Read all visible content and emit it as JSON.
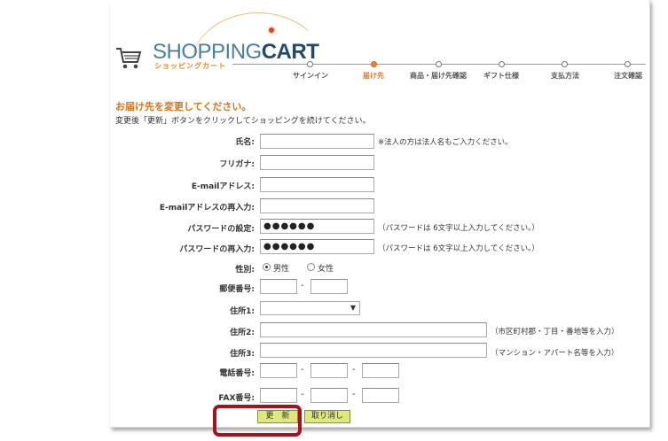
{
  "logo": {
    "main_light": "SHOPPING",
    "main_bold": "CART",
    "sub": "ショッピングカート"
  },
  "steps": [
    {
      "label": "サインイン",
      "active": false
    },
    {
      "label": "届け先",
      "active": true
    },
    {
      "label": "商品・届け先確認",
      "active": false
    },
    {
      "label": "ギフト仕様",
      "active": false
    },
    {
      "label": "支払方法",
      "active": false
    },
    {
      "label": "注文確認",
      "active": false
    }
  ],
  "form": {
    "title": "お届け先を変更してください。",
    "description": "変更後「更新」ボタンをクリックしてショッピングを続けてください。",
    "name": {
      "label": "氏名:",
      "value": "",
      "hint": "※法人の方は法人名もご入力ください。"
    },
    "furigana": {
      "label": "フリガナ:",
      "value": ""
    },
    "email": {
      "label": "E-mailアドレス:",
      "value": ""
    },
    "email_confirm": {
      "label": "E-mailアドレスの再入力:",
      "value": ""
    },
    "password": {
      "label": "パスワードの設定:",
      "value": "●●●●●●",
      "hint": "（パスワードは 6文字以上入力してください。）"
    },
    "password_confirm": {
      "label": "パスワードの再入力:",
      "value": "●●●●●●",
      "hint": "（パスワードは 6文字以上入力してください。）"
    },
    "gender": {
      "label": "性別:",
      "options": [
        "男性",
        "女性"
      ],
      "selected": "男性"
    },
    "postal": {
      "label": "郵便番号:",
      "part1": "",
      "part2": "",
      "sep": "-"
    },
    "address1": {
      "label": "住所1:",
      "selected": ""
    },
    "address2": {
      "label": "住所2:",
      "value": "",
      "hint": "（市区町村郡・丁目・番地等を入力）"
    },
    "address3": {
      "label": "住所3:",
      "value": "",
      "hint": "（マンション・アパート名等を入力）"
    },
    "phone": {
      "label": "電話番号:",
      "part1": "",
      "part2": "",
      "part3": "",
      "sep": "-"
    },
    "fax": {
      "label": "FAX番号:",
      "part1": "",
      "part2": "",
      "part3": "",
      "sep": "-"
    },
    "buttons": {
      "update": "更　新",
      "cancel": "取り消し"
    }
  },
  "colors": {
    "accent": "#f07020",
    "highlight": "#a8111a",
    "button": "#dfe87a"
  }
}
